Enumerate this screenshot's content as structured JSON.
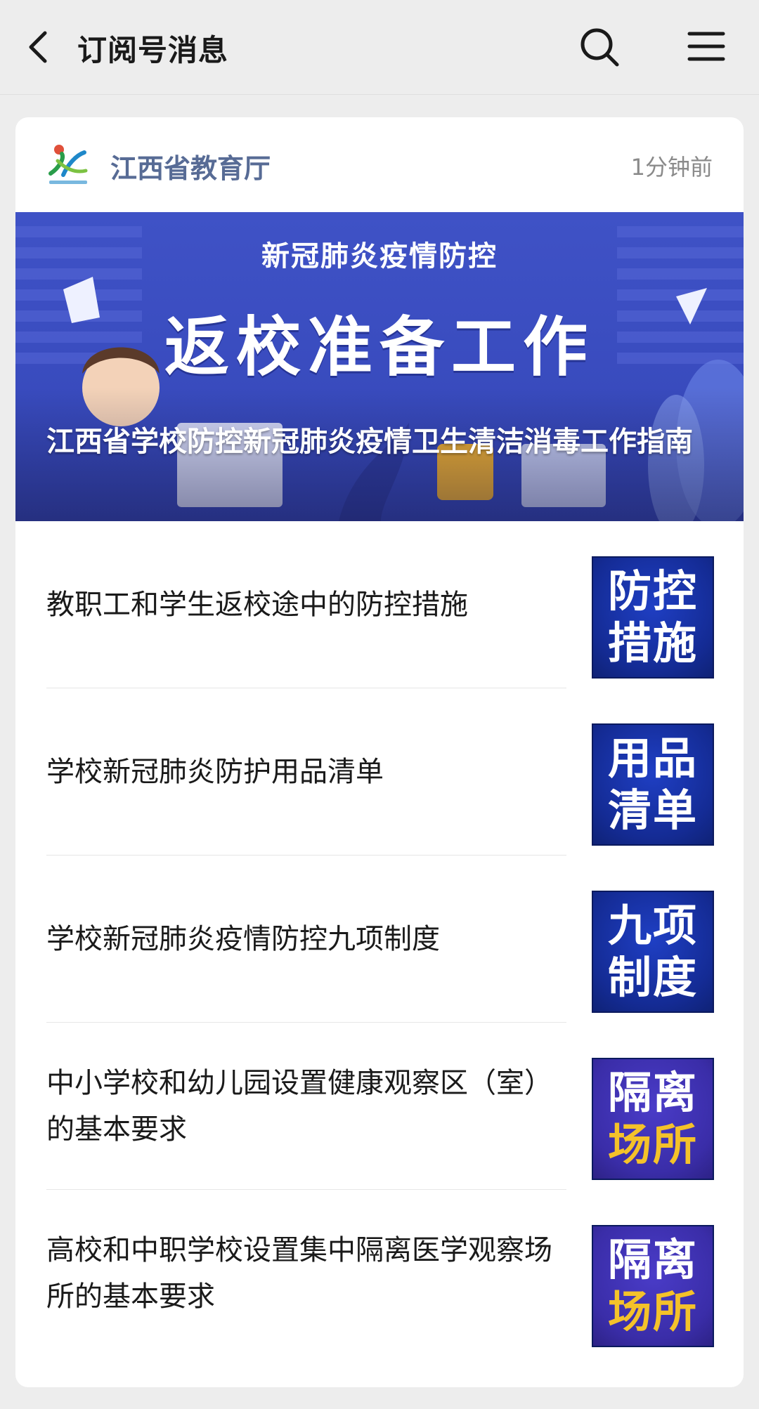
{
  "header": {
    "title": "订阅号消息"
  },
  "card": {
    "account_name": "江西省教育厅",
    "time": "1分钟前",
    "banner": {
      "subtitle": "新冠肺炎疫情防控",
      "main_text": "返校准备工作",
      "article_title": "江西省学校防控新冠肺炎疫情卫生清洁消毒工作指南"
    }
  },
  "articles": [
    {
      "title": "教职工和学生返校途中的防控措施",
      "thumb_line1": "防控",
      "thumb_line2": "措施"
    },
    {
      "title": "学校新冠肺炎防护用品清单",
      "thumb_line1": "用品",
      "thumb_line2": "清单"
    },
    {
      "title": "学校新冠肺炎疫情防控九项制度",
      "thumb_line1": "九项",
      "thumb_line2": "制度"
    },
    {
      "title": "中小学校和幼儿园设置健康观察区（室）的基本要求",
      "thumb_line1": "隔离",
      "thumb_line2": "场所"
    },
    {
      "title": "高校和中职学校设置集中隔离医学观察场所的基本要求",
      "thumb_line1": "隔离",
      "thumb_line2": "场所"
    }
  ],
  "colors": {
    "background": "#ededed",
    "account_name": "#576b95",
    "banner_blue": "#3f52c6",
    "thumb_blue": "#142b94",
    "thumb_purple": "#3a2da8",
    "thumb_gold": "#f4c22a"
  }
}
